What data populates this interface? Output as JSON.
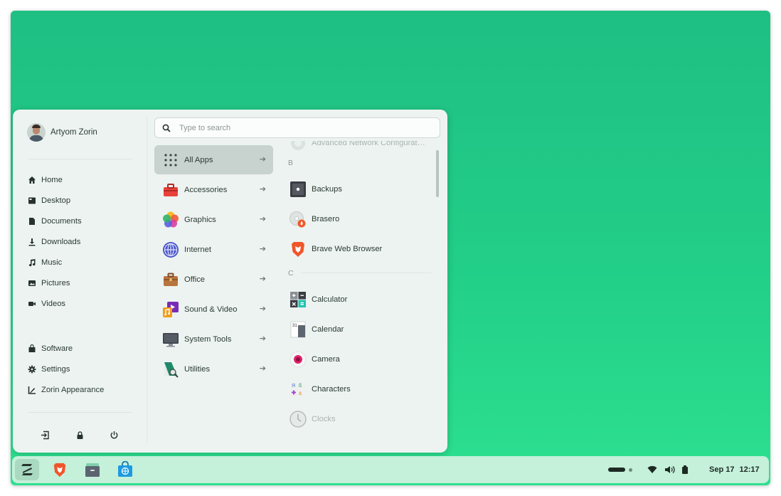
{
  "user": {
    "name": "Artyom Zorin"
  },
  "places": [
    {
      "label": "Home",
      "icon": "home-icon"
    },
    {
      "label": "Desktop",
      "icon": "desktop-icon"
    },
    {
      "label": "Documents",
      "icon": "document-icon"
    },
    {
      "label": "Downloads",
      "icon": "download-icon"
    },
    {
      "label": "Music",
      "icon": "music-icon"
    },
    {
      "label": "Pictures",
      "icon": "picture-icon"
    },
    {
      "label": "Videos",
      "icon": "video-icon"
    }
  ],
  "system": [
    {
      "label": "Software",
      "icon": "software-icon"
    },
    {
      "label": "Settings",
      "icon": "gear-icon"
    },
    {
      "label": "Zorin Appearance",
      "icon": "appearance-icon"
    }
  ],
  "session_icons": [
    "logout-icon",
    "lock-icon",
    "power-icon"
  ],
  "search": {
    "placeholder": "Type to search"
  },
  "categories": [
    {
      "label": "All Apps",
      "active": true
    },
    {
      "label": "Accessories"
    },
    {
      "label": "Graphics"
    },
    {
      "label": "Internet"
    },
    {
      "label": "Office"
    },
    {
      "label": "Sound & Video"
    },
    {
      "label": "System Tools"
    },
    {
      "label": "Utilities"
    }
  ],
  "apps": {
    "partial_top": "Advanced Network Configurat…",
    "section_b": "B",
    "section_c": "C",
    "b_items": [
      "Backups",
      "Brasero",
      "Brave Web Browser"
    ],
    "c_items": [
      "Calculator",
      "Calendar",
      "Camera",
      "Characters",
      "Clocks"
    ]
  },
  "taskbar": {
    "apps": [
      "zorin-menu-icon",
      "brave-icon",
      "files-icon",
      "software-store-icon"
    ],
    "date": "Sep 17",
    "time": "12:17"
  },
  "colors": {
    "desktop_top": "#1fbf83",
    "desktop_bottom": "#2de08f",
    "menu_bg": "#edf3f1",
    "taskbar_bg": "#c5f0da",
    "accent": "#15a46b"
  }
}
